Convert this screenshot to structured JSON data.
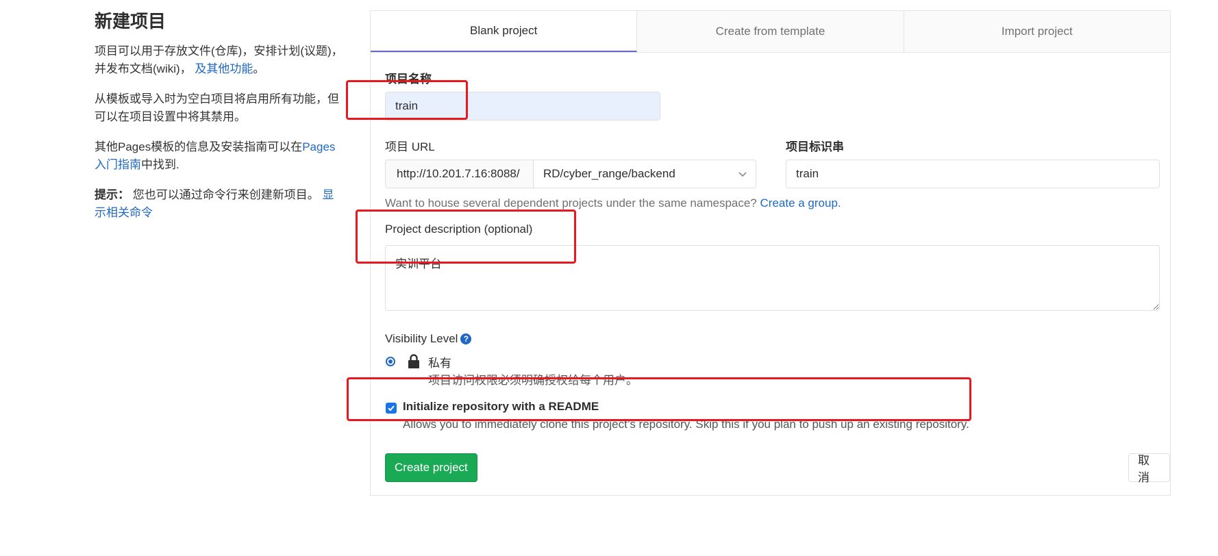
{
  "intro": {
    "title": "新建项目",
    "p1_text": "项目可以用于存放文件(仓库)，安排计划(议题)，并发布文档(wiki)，",
    "p1_link": "及其他功能",
    "p1_end": "。",
    "p2": "从模板或导入时为空白项目将启用所有功能，但可以在项目设置中将其禁用。",
    "p3_text": "其他Pages模板的信息及安装指南可以在",
    "p3_link": "Pages入门指南",
    "p3_end": "中找到.",
    "tip_label": "提示：",
    "tip_text": "您也可以通过命令行来创建新项目。",
    "tip_link": "显示相关命令"
  },
  "tabs": [
    {
      "label": "Blank project",
      "active": true
    },
    {
      "label": "Create from template",
      "active": false
    },
    {
      "label": "Import project",
      "active": false
    }
  ],
  "form": {
    "name_label": "项目名称",
    "name_value": "train",
    "url_label": "项目 URL",
    "url_prefix": "http://10.201.7.16:8088/",
    "url_namespace": "RD/cyber_range/backend",
    "slug_label": "项目标识串",
    "slug_value": "train",
    "namespace_help": "Want to house several dependent projects under the same namespace?",
    "namespace_help_link": "Create a group.",
    "desc_label": "Project description (optional)",
    "desc_value": "实训平台",
    "visibility_label": "Visibility Level",
    "visibility_help_icon": "?",
    "visibility_option_label": "私有",
    "visibility_option_desc": "项目访问权限必须明确授权给每个用户。",
    "readme_label": "Initialize repository with a README",
    "readme_desc": "Allows you to immediately clone this project’s repository. Skip this if you plan to push up an existing repository.",
    "create_button": "Create project",
    "cancel_button": "取消"
  },
  "colors": {
    "accent": "#1f68c1",
    "primary_button": "#1aaa55",
    "annotation_red": "#e8191e",
    "active_tab_underline": "#6666c4"
  }
}
